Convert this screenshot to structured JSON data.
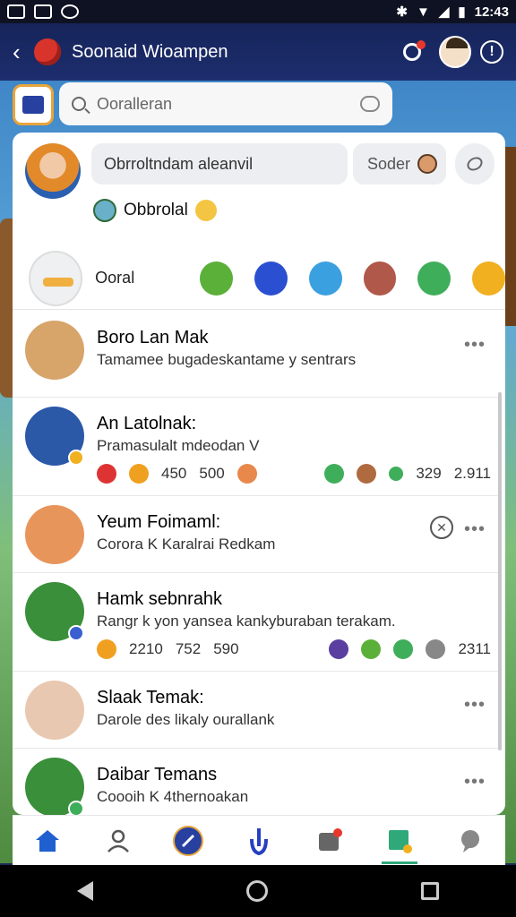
{
  "status": {
    "left_icons": [
      "sim-icon",
      "image-icon",
      "app-icon"
    ],
    "time": "12:43"
  },
  "header": {
    "title": "Soonaid Wioampen"
  },
  "search": {
    "placeholder": "Ooralleran"
  },
  "composer": {
    "input_text": "Obrroltndam aleanvil",
    "send_label": "Soder",
    "subline": "Obbrolal"
  },
  "stories": {
    "label": "Ooral",
    "icons": [
      {
        "name": "leaf-icon",
        "color": "#5bb039"
      },
      {
        "name": "box-icon",
        "color": "#2a4fd0"
      },
      {
        "name": "bird-icon",
        "color": "#3aa0e0"
      },
      {
        "name": "face-icon",
        "color": "#b0584a"
      },
      {
        "name": "chat-icon",
        "color": "#3fae5b"
      },
      {
        "name": "home-icon",
        "color": "#f0b020"
      }
    ]
  },
  "friends": [
    {
      "name": "Boro Lan Mak",
      "message": "Tamamee bugadeskantame y sentrars",
      "avatar_color": "#d7a46a",
      "badge": "",
      "more": "•••"
    },
    {
      "name": "An Latolnak:",
      "message": "Pramasulalt mdeodan V",
      "avatar_color": "#2c58a8",
      "badge": "#f0b020",
      "stats": {
        "a": "450",
        "b": "500",
        "c": "329",
        "d": "2.911"
      }
    },
    {
      "name": "Yeum Foimaml:",
      "message": "Corora K Karalrai Redkam",
      "avatar_color": "#e8955c",
      "badge": "",
      "more": "•••",
      "close_glyph": "✕"
    },
    {
      "name": "Hamk sebnrahk",
      "message": "Rangr k yon yansea kankyburaban terakam.",
      "avatar_color": "#3a8f3a",
      "badge": "#3a5fd0",
      "stats": {
        "a": "2210",
        "b": "752",
        "c": "590",
        "d": "2311"
      }
    },
    {
      "name": "Slaak Temak:",
      "message": "Darole des likaly ourallank",
      "avatar_color": "#e8c8b0",
      "badge": "",
      "more": "•••"
    },
    {
      "name": "Daibar Temans",
      "message": "Coooih K 4thernoakan",
      "avatar_color": "#3a8f3a",
      "badge": "#3fae5b",
      "more": "•••"
    }
  ],
  "tabs": [
    {
      "name": "tab-home",
      "color": "#1f5fd0"
    },
    {
      "name": "tab-profile",
      "color": "#555"
    },
    {
      "name": "tab-compass",
      "color": "#2840a0"
    },
    {
      "name": "tab-hand",
      "color": "#2840c0"
    },
    {
      "name": "tab-inbox",
      "color": "#666"
    },
    {
      "name": "tab-gallery",
      "color": "#2fa87a"
    },
    {
      "name": "tab-chat",
      "color": "#888"
    }
  ]
}
